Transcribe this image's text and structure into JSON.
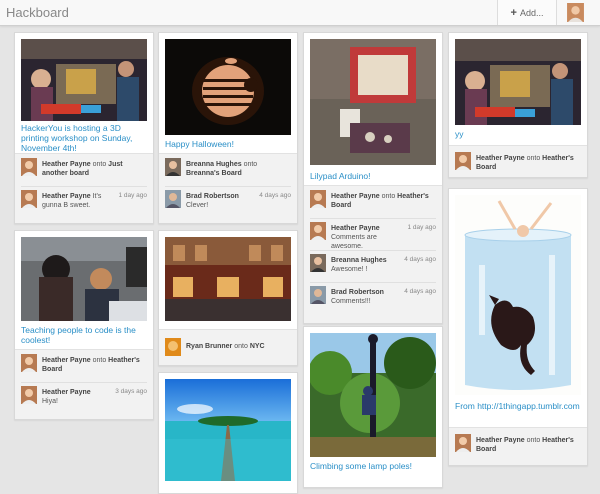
{
  "app": {
    "title": "Hackboard",
    "add_label": "Add..."
  },
  "cards": [
    {
      "caption": "HackerYou is hosting a 3D printing workshop on Sunday, November 4th!",
      "activity": [
        {
          "user": "Heather Payne",
          "verb": "onto",
          "target": "Just another board"
        },
        {
          "user": "Heather Payne",
          "comment": "It's gunna B sweet.",
          "time": "1 day ago"
        }
      ]
    },
    {
      "caption": "Teaching people to code is the coolest!",
      "activity": [
        {
          "user": "Heather Payne",
          "verb": "onto",
          "target": "Heather's Board"
        },
        {
          "user": "Heather Payne",
          "comment": "Hiya!",
          "time": "3 days ago"
        }
      ]
    },
    {
      "caption": "Happy Halloween!",
      "activity": [
        {
          "user": "Breanna Hughes",
          "verb": "onto",
          "target": "Breanna's Board"
        },
        {
          "user": "Brad Robertson",
          "comment": "Clever!",
          "time": "4 days ago"
        }
      ]
    },
    {
      "caption": "",
      "activity": [
        {
          "user": "Ryan Brunner",
          "verb": "onto",
          "target": "NYC"
        }
      ]
    },
    {
      "caption": "Lilypad Arduino!",
      "activity": [
        {
          "user": "Heather Payne",
          "verb": "onto",
          "target": "Heather's Board"
        },
        {
          "user": "Heather Payne",
          "comment": "Comments are awesome.",
          "time": "1 day ago"
        },
        {
          "user": "Breanna Hughes",
          "comment": "Awesome! !",
          "time": "4 days ago"
        },
        {
          "user": "Brad Robertson",
          "comment": "Comments!!!",
          "time": "4 days ago"
        }
      ]
    },
    {
      "caption": "Climbing some lamp poles!"
    },
    {
      "caption": "yy",
      "activity": [
        {
          "user": "Heather Payne",
          "verb": "onto",
          "target": "Heather's Board"
        }
      ]
    },
    {
      "caption": "From http://1thingapp.tumblr.com",
      "activity": [
        {
          "user": "Heather Payne",
          "verb": "onto",
          "target": "Heather's Board"
        }
      ]
    }
  ]
}
